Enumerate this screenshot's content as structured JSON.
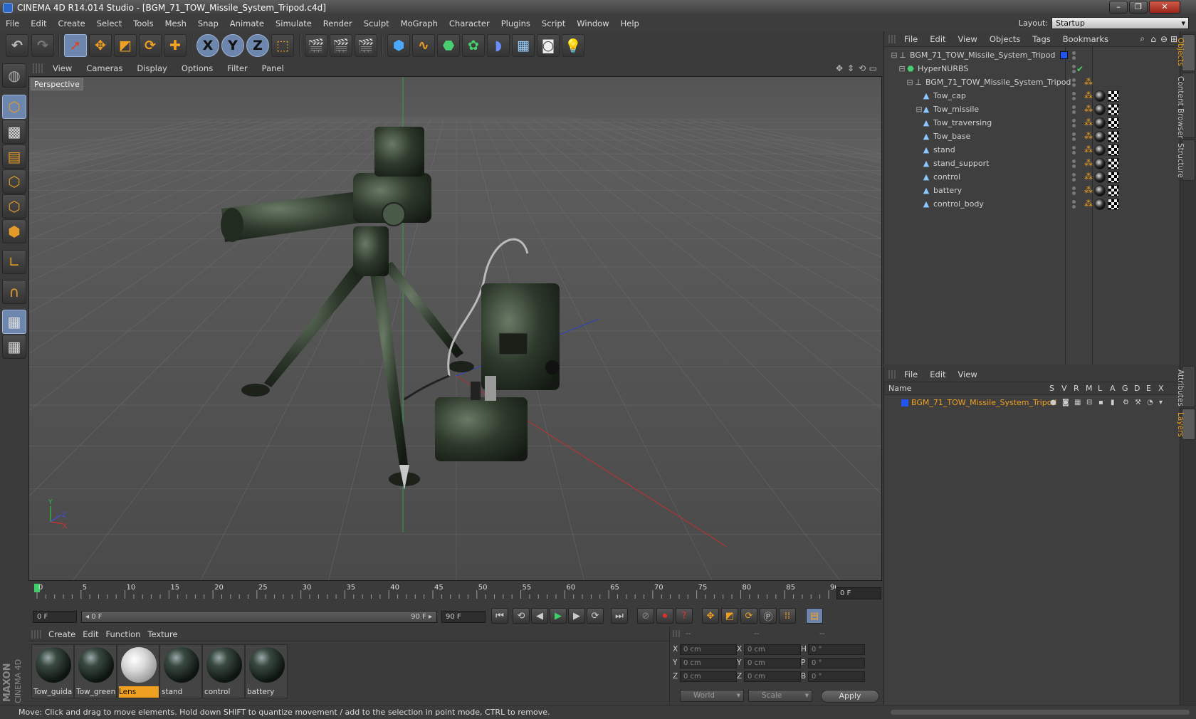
{
  "window": {
    "title": "CINEMA 4D R14.014 Studio - [BGM_71_TOW_Missile_System_Tripod.c4d]",
    "controls": [
      "–",
      "❐",
      "✕"
    ]
  },
  "menubar": {
    "items": [
      "File",
      "Edit",
      "Create",
      "Select",
      "Tools",
      "Mesh",
      "Snap",
      "Animate",
      "Simulate",
      "Render",
      "Sculpt",
      "MoGraph",
      "Character",
      "Plugins",
      "Script",
      "Window",
      "Help"
    ],
    "layout_label": "Layout:",
    "layout_value": "Startup"
  },
  "toolbar": {
    "axis_x": "X",
    "axis_y": "Y",
    "axis_z": "Z"
  },
  "viewport": {
    "menu": [
      "View",
      "Cameras",
      "Display",
      "Options",
      "Filter",
      "Panel"
    ],
    "camera_label": "Perspective",
    "axis_labels": {
      "x": "X",
      "y": "Y",
      "z": "Z"
    }
  },
  "timeline": {
    "ticks": [
      "0",
      "5",
      "10",
      "15",
      "20",
      "25",
      "30",
      "35",
      "40",
      "45",
      "50",
      "55",
      "60",
      "65",
      "70",
      "75",
      "80",
      "85",
      "90"
    ],
    "current_frame": "0 F"
  },
  "transport": {
    "start_field": "0 F",
    "range_start": "◂ 0 F",
    "range_end": "90 F ▸",
    "end_field": "90 F"
  },
  "materials": {
    "menu": [
      "Create",
      "Edit",
      "Function",
      "Texture"
    ],
    "items": [
      {
        "name": "Tow_guida",
        "selected": false,
        "kind": "dark"
      },
      {
        "name": "Tow_green",
        "selected": false,
        "kind": "dark"
      },
      {
        "name": "Lens",
        "selected": true,
        "kind": "lens"
      },
      {
        "name": "stand",
        "selected": false,
        "kind": "dark"
      },
      {
        "name": "control",
        "selected": false,
        "kind": "dark"
      },
      {
        "name": "battery",
        "selected": false,
        "kind": "dark"
      }
    ]
  },
  "coordinates": {
    "headers": [
      "--",
      "--",
      "--"
    ],
    "rows": [
      {
        "a": "X",
        "av": "0 cm",
        "b": "X",
        "bv": "0 cm",
        "c": "H",
        "cv": "0 °"
      },
      {
        "a": "Y",
        "av": "0 cm",
        "b": "Y",
        "bv": "0 cm",
        "c": "P",
        "cv": "0 °"
      },
      {
        "a": "Z",
        "av": "0 cm",
        "b": "Z",
        "bv": "0 cm",
        "c": "B",
        "cv": "0 °"
      }
    ],
    "mode": "World",
    "scale": "Scale",
    "apply": "Apply"
  },
  "status": {
    "text": "Move: Click and drag to move elements. Hold down SHIFT to quantize movement / add to the selection in point mode, CTRL to remove."
  },
  "object_manager": {
    "menu": [
      "File",
      "Edit",
      "View",
      "Objects",
      "Tags",
      "Bookmarks"
    ],
    "objects": [
      {
        "name": "BGM_71_TOW_Missile_System_Tripod",
        "depth": 0,
        "icon": "null",
        "tags": "layer"
      },
      {
        "name": "HyperNURBS",
        "depth": 1,
        "icon": "nurbs",
        "tags": "check"
      },
      {
        "name": "BGM_71_TOW_Missile_System_Tripod",
        "depth": 2,
        "icon": "null",
        "tags": "phong"
      },
      {
        "name": "Tow_cap",
        "depth": 3,
        "icon": "poly",
        "tags": "mat"
      },
      {
        "name": "Tow_missile",
        "depth": 3,
        "icon": "poly",
        "tags": "mat",
        "expand": true
      },
      {
        "name": "Tow_traversing",
        "depth": 3,
        "icon": "poly",
        "tags": "mat"
      },
      {
        "name": "Tow_base",
        "depth": 3,
        "icon": "poly",
        "tags": "mat"
      },
      {
        "name": "stand",
        "depth": 3,
        "icon": "poly",
        "tags": "mat"
      },
      {
        "name": "stand_support",
        "depth": 3,
        "icon": "poly",
        "tags": "mat"
      },
      {
        "name": "control",
        "depth": 3,
        "icon": "poly",
        "tags": "mat"
      },
      {
        "name": "battery",
        "depth": 3,
        "icon": "poly",
        "tags": "mat"
      },
      {
        "name": "control_body",
        "depth": 3,
        "icon": "poly",
        "tags": "mat"
      }
    ]
  },
  "layer_manager": {
    "menu": [
      "File",
      "Edit",
      "View"
    ],
    "columns": [
      "Name",
      "S",
      "V",
      "R",
      "M",
      "L",
      "A",
      "G",
      "D",
      "E",
      "X"
    ],
    "layers": [
      {
        "name": "BGM_71_TOW_Missile_System_Tripod",
        "color": "#2255ee"
      }
    ]
  },
  "right_tabs": {
    "top": [
      "Objects",
      "Content Browser",
      "Structure"
    ],
    "bottom": [
      "Attributes",
      "Layers"
    ]
  },
  "colors": {
    "accent": "#f0a020",
    "selection": "#6d86ad",
    "layer_blue": "#2255ee"
  }
}
